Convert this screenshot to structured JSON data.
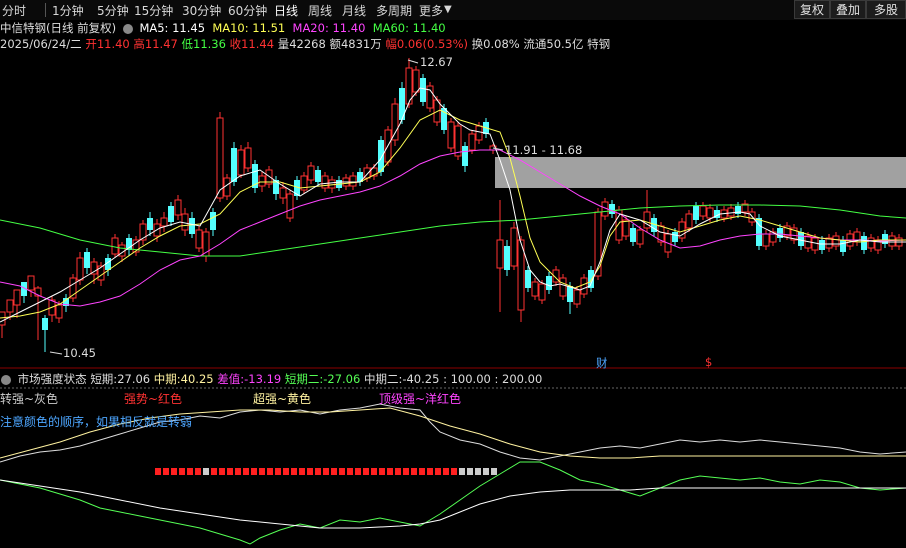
{
  "toolbar": {
    "timeframes": [
      "分时",
      "1分钟",
      "5分钟",
      "15分钟",
      "30分钟",
      "60分钟",
      "日线",
      "周线",
      "月线",
      "多周期",
      "更多"
    ],
    "active_index": 6,
    "right_buttons": [
      "复权",
      "叠加",
      "多股"
    ]
  },
  "header": {
    "title": "中信特钢(日线 前复权)",
    "ma": [
      {
        "label": "MA5: 11.45",
        "color": "#ffffff"
      },
      {
        "label": "MA10: 11.51",
        "color": "#ffff55"
      },
      {
        "label": "MA20: 11.40",
        "color": "#ff44ff"
      },
      {
        "label": "MA60: 11.40",
        "color": "#44ff44"
      }
    ]
  },
  "quote": {
    "date": "2025/06/24/二",
    "open_label": "开",
    "open": "11.40",
    "high_label": "高",
    "high": "11.47",
    "low_label": "低",
    "low": "11.36",
    "close_label": "收",
    "close": "11.44",
    "vol_label": "量",
    "vol": "42268",
    "amt_label": "额",
    "amt": "4831万",
    "chg_label": "幅",
    "chg": "0.06(0.53%)",
    "turnover": "换0.08%",
    "float": "流通50.5亿",
    "sector": "特钢"
  },
  "annotations": {
    "high_price": "12.67",
    "low_price": "10.45",
    "zone": "11.91 - 11.68",
    "marker_cai": "财",
    "marker_s": "$"
  },
  "indicator": {
    "name": "市场强度状态",
    "short_label": "短期:",
    "short": "27.06",
    "mid_label": "中期:",
    "mid": "40.25",
    "diff_label": "差值:",
    "diff": "-13.19",
    "short2_label": "短期二:",
    "short2": "-27.06",
    "mid2_label": "中期二:",
    "mid2": "-40.25",
    "tail": ": 100.00 : 200.00",
    "legend_gray": "转强~灰色",
    "legend_red": "强势~红色",
    "legend_yellow": "超强~黄色",
    "legend_top": "顶级强~洋红色",
    "note": "注意颜色的顺序，如果相反就是转弱"
  },
  "colors": {
    "up": "#ff3232",
    "down": "#54ffff",
    "ma5": "#ffffff",
    "ma10": "#ffff55",
    "ma20": "#ff44ff",
    "ma60": "#44ff44",
    "zone": "#bdbdbd"
  },
  "candles": [
    [
      2,
      312,
      325,
      318,
      338
    ],
    [
      10,
      300,
      312,
      306,
      320
    ],
    [
      17,
      290,
      305,
      298,
      318
    ],
    [
      24,
      282,
      296,
      285,
      303
    ],
    [
      31,
      276,
      290,
      282,
      297
    ],
    [
      38,
      288,
      296,
      286,
      340
    ],
    [
      45,
      318,
      330,
      315,
      352
    ],
    [
      52,
      300,
      315,
      296,
      322
    ],
    [
      59,
      305,
      318,
      301,
      323
    ],
    [
      66,
      298,
      306,
      294,
      312
    ],
    [
      73,
      278,
      298,
      274,
      302
    ],
    [
      80,
      258,
      280,
      252,
      285
    ],
    [
      87,
      252,
      268,
      248,
      274
    ],
    [
      94,
      262,
      274,
      258,
      284
    ],
    [
      101,
      266,
      280,
      262,
      286
    ],
    [
      108,
      258,
      270,
      254,
      276
    ],
    [
      115,
      238,
      254,
      234,
      258
    ],
    [
      122,
      245,
      256,
      242,
      262
    ],
    [
      129,
      238,
      250,
      234,
      256
    ],
    [
      136,
      240,
      252,
      236,
      256
    ],
    [
      143,
      224,
      240,
      220,
      245
    ],
    [
      150,
      218,
      230,
      212,
      236
    ],
    [
      157,
      224,
      236,
      219,
      242
    ],
    [
      164,
      218,
      226,
      212,
      232
    ],
    [
      171,
      206,
      222,
      202,
      226
    ],
    [
      178,
      200,
      215,
      195,
      220
    ],
    [
      185,
      214,
      230,
      208,
      236
    ],
    [
      192,
      218,
      234,
      212,
      238
    ],
    [
      199,
      230,
      248,
      226,
      252
    ],
    [
      206,
      232,
      256,
      228,
      262
    ],
    [
      213,
      212,
      230,
      208,
      236
    ],
    [
      220,
      118,
      198,
      112,
      202
    ],
    [
      227,
      178,
      196,
      174,
      200
    ],
    [
      234,
      148,
      182,
      142,
      186
    ],
    [
      241,
      150,
      175,
      145,
      178
    ],
    [
      248,
      148,
      168,
      142,
      172
    ],
    [
      255,
      164,
      188,
      160,
      193
    ],
    [
      262,
      176,
      186,
      172,
      192
    ],
    [
      269,
      170,
      184,
      166,
      188
    ],
    [
      276,
      180,
      194,
      176,
      200
    ],
    [
      283,
      188,
      198,
      182,
      204
    ],
    [
      290,
      194,
      218,
      190,
      222
    ],
    [
      297,
      180,
      196,
      176,
      200
    ],
    [
      304,
      176,
      190,
      172,
      194
    ],
    [
      311,
      166,
      180,
      162,
      184
    ],
    [
      318,
      170,
      182,
      166,
      186
    ],
    [
      325,
      176,
      188,
      172,
      192
    ],
    [
      332,
      180,
      188,
      176,
      193
    ],
    [
      339,
      180,
      188,
      176,
      191
    ],
    [
      346,
      178,
      186,
      174,
      190
    ],
    [
      353,
      176,
      186,
      172,
      190
    ],
    [
      360,
      172,
      182,
      168,
      186
    ],
    [
      367,
      168,
      178,
      164,
      182
    ],
    [
      374,
      168,
      176,
      164,
      180
    ],
    [
      381,
      140,
      172,
      136,
      176
    ],
    [
      388,
      130,
      162,
      126,
      166
    ],
    [
      395,
      104,
      140,
      98,
      146
    ],
    [
      402,
      88,
      120,
      82,
      124
    ],
    [
      409,
      68,
      104,
      58,
      108
    ],
    [
      416,
      70,
      92,
      66,
      96
    ],
    [
      423,
      78,
      102,
      74,
      106
    ],
    [
      430,
      86,
      108,
      82,
      112
    ],
    [
      437,
      100,
      122,
      96,
      126
    ],
    [
      444,
      108,
      130,
      104,
      134
    ],
    [
      451,
      122,
      148,
      118,
      152
    ],
    [
      458,
      126,
      156,
      122,
      160
    ],
    [
      465,
      146,
      166,
      142,
      172
    ],
    [
      472,
      134,
      150,
      130,
      154
    ],
    [
      479,
      126,
      140,
      122,
      144
    ],
    [
      486,
      122,
      134,
      118,
      138
    ],
    [
      493,
      146,
      150,
      144,
      154
    ],
    [
      500,
      240,
      268,
      200,
      312
    ],
    [
      507,
      246,
      270,
      240,
      276
    ],
    [
      514,
      228,
      266,
      222,
      270
    ],
    [
      521,
      240,
      310,
      236,
      322
    ],
    [
      528,
      270,
      288,
      266,
      292
    ],
    [
      535,
      282,
      296,
      278,
      300
    ],
    [
      542,
      284,
      300,
      280,
      304
    ],
    [
      549,
      276,
      290,
      272,
      294
    ],
    [
      556,
      270,
      282,
      266,
      286
    ],
    [
      563,
      278,
      296,
      274,
      300
    ],
    [
      570,
      286,
      302,
      282,
      314
    ],
    [
      577,
      290,
      304,
      286,
      308
    ],
    [
      584,
      278,
      294,
      274,
      298
    ],
    [
      591,
      270,
      288,
      266,
      292
    ],
    [
      598,
      212,
      276,
      208,
      280
    ],
    [
      605,
      202,
      216,
      198,
      220
    ],
    [
      612,
      204,
      214,
      200,
      218
    ],
    [
      619,
      210,
      240,
      206,
      244
    ],
    [
      626,
      220,
      236,
      216,
      240
    ],
    [
      633,
      228,
      242,
      224,
      246
    ],
    [
      640,
      230,
      244,
      226,
      248
    ],
    [
      647,
      212,
      228,
      190,
      232
    ],
    [
      654,
      218,
      232,
      214,
      236
    ],
    [
      661,
      226,
      242,
      222,
      246
    ],
    [
      668,
      234,
      252,
      230,
      258
    ],
    [
      675,
      232,
      242,
      228,
      246
    ],
    [
      682,
      222,
      238,
      218,
      242
    ],
    [
      689,
      214,
      228,
      210,
      232
    ],
    [
      696,
      206,
      220,
      202,
      224
    ],
    [
      703,
      206,
      216,
      202,
      220
    ],
    [
      710,
      208,
      218,
      204,
      222
    ],
    [
      717,
      210,
      218,
      206,
      222
    ],
    [
      724,
      210,
      218,
      206,
      222
    ],
    [
      731,
      208,
      216,
      204,
      220
    ],
    [
      738,
      206,
      214,
      202,
      218
    ],
    [
      745,
      204,
      212,
      200,
      216
    ],
    [
      752,
      212,
      222,
      208,
      226
    ],
    [
      759,
      218,
      246,
      214,
      250
    ],
    [
      766,
      234,
      246,
      230,
      250
    ],
    [
      773,
      232,
      242,
      228,
      246
    ],
    [
      780,
      228,
      238,
      224,
      242
    ],
    [
      787,
      226,
      236,
      222,
      240
    ],
    [
      794,
      228,
      240,
      224,
      244
    ],
    [
      801,
      232,
      246,
      228,
      250
    ],
    [
      808,
      236,
      248,
      232,
      252
    ],
    [
      815,
      238,
      250,
      234,
      254
    ],
    [
      822,
      240,
      250,
      236,
      254
    ],
    [
      829,
      238,
      248,
      234,
      252
    ],
    [
      836,
      236,
      246,
      232,
      250
    ],
    [
      843,
      240,
      252,
      236,
      256
    ],
    [
      850,
      234,
      246,
      230,
      250
    ],
    [
      857,
      232,
      242,
      228,
      246
    ],
    [
      864,
      236,
      250,
      232,
      254
    ],
    [
      871,
      238,
      248,
      234,
      252
    ],
    [
      878,
      240,
      250,
      236,
      254
    ],
    [
      885,
      234,
      244,
      230,
      248
    ],
    [
      892,
      236,
      246,
      232,
      250
    ],
    [
      899,
      238,
      246,
      234,
      250
    ]
  ],
  "bars_indicator": {
    "red_count": 38,
    "gray_count": 5
  }
}
